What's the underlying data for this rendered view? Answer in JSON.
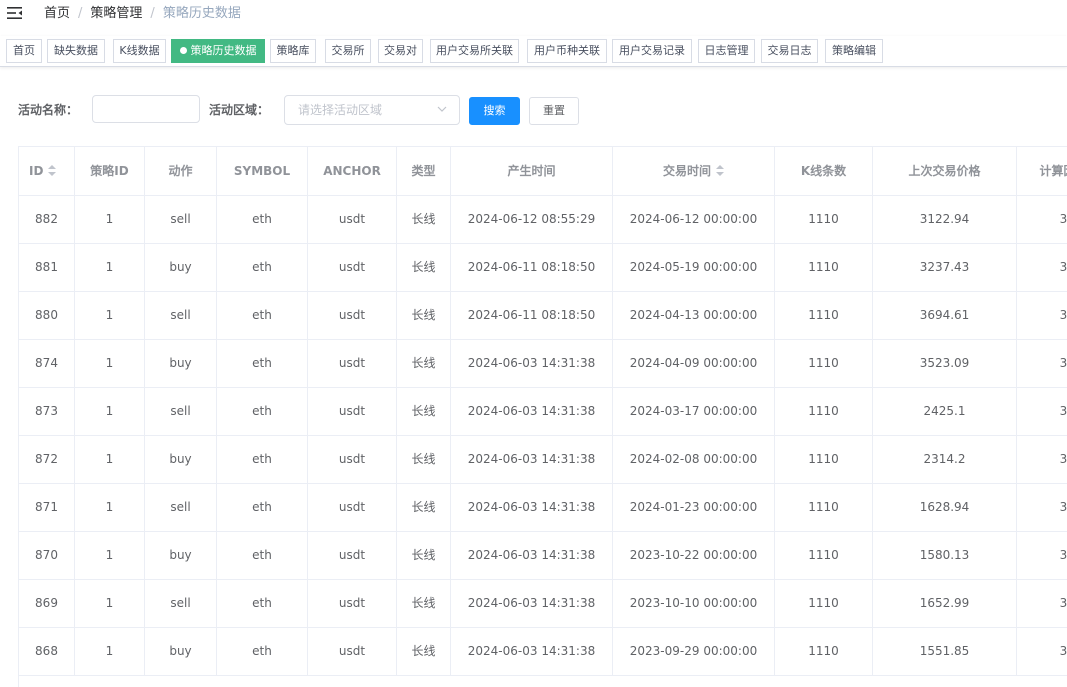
{
  "breadcrumb": {
    "home": "首页",
    "parent": "策略管理",
    "current": "策略历史数据"
  },
  "tags": [
    "首页",
    "缺失数据",
    "K线数据",
    "策略历史数据",
    "策略库",
    "交易所",
    "交易对",
    "用户交易所关联",
    "用户币种关联",
    "用户交易记录",
    "日志管理",
    "交易日志",
    "策略编辑"
  ],
  "active_tag": "策略历史数据",
  "search": {
    "name_label": "活动名称：",
    "name_value": "",
    "area_label": "活动区域：",
    "area_placeholder": "请选择活动区域",
    "search_button": "搜索",
    "reset_button": "重置"
  },
  "table": {
    "columns": [
      "ID",
      "策略ID",
      "动作",
      "SYMBOL",
      "ANCHOR",
      "类型",
      "产生时间",
      "交易时间",
      "K线条数",
      "上次交易价格",
      "计算因子"
    ],
    "sortable": [
      "ID",
      "交易时间"
    ],
    "rows": [
      [
        "882",
        "1",
        "sell",
        "eth",
        "usdt",
        "长线",
        "2024-06-12 08:55:29",
        "2024-06-12 00:00:00",
        "1110",
        "3122.94",
        "3"
      ],
      [
        "881",
        "1",
        "buy",
        "eth",
        "usdt",
        "长线",
        "2024-06-11 08:18:50",
        "2024-05-19 00:00:00",
        "1110",
        "3237.43",
        "3"
      ],
      [
        "880",
        "1",
        "sell",
        "eth",
        "usdt",
        "长线",
        "2024-06-11 08:18:50",
        "2024-04-13 00:00:00",
        "1110",
        "3694.61",
        "3"
      ],
      [
        "874",
        "1",
        "buy",
        "eth",
        "usdt",
        "长线",
        "2024-06-03 14:31:38",
        "2024-04-09 00:00:00",
        "1110",
        "3523.09",
        "3"
      ],
      [
        "873",
        "1",
        "sell",
        "eth",
        "usdt",
        "长线",
        "2024-06-03 14:31:38",
        "2024-03-17 00:00:00",
        "1110",
        "2425.1",
        "3"
      ],
      [
        "872",
        "1",
        "buy",
        "eth",
        "usdt",
        "长线",
        "2024-06-03 14:31:38",
        "2024-02-08 00:00:00",
        "1110",
        "2314.2",
        "3"
      ],
      [
        "871",
        "1",
        "sell",
        "eth",
        "usdt",
        "长线",
        "2024-06-03 14:31:38",
        "2024-01-23 00:00:00",
        "1110",
        "1628.94",
        "3"
      ],
      [
        "870",
        "1",
        "buy",
        "eth",
        "usdt",
        "长线",
        "2024-06-03 14:31:38",
        "2023-10-22 00:00:00",
        "1110",
        "1580.13",
        "3"
      ],
      [
        "869",
        "1",
        "sell",
        "eth",
        "usdt",
        "长线",
        "2024-06-03 14:31:38",
        "2023-10-10 00:00:00",
        "1110",
        "1652.99",
        "3"
      ],
      [
        "868",
        "1",
        "buy",
        "eth",
        "usdt",
        "长线",
        "2024-06-03 14:31:38",
        "2023-09-29 00:00:00",
        "1110",
        "1551.85",
        "3"
      ]
    ]
  },
  "colors": {
    "active_tag": "#42b983",
    "primary": "#1890ff",
    "border": "#ebeef5"
  },
  "icons": [
    "hamburger-icon",
    "chevron-down-icon",
    "sort-caret-icon"
  ]
}
